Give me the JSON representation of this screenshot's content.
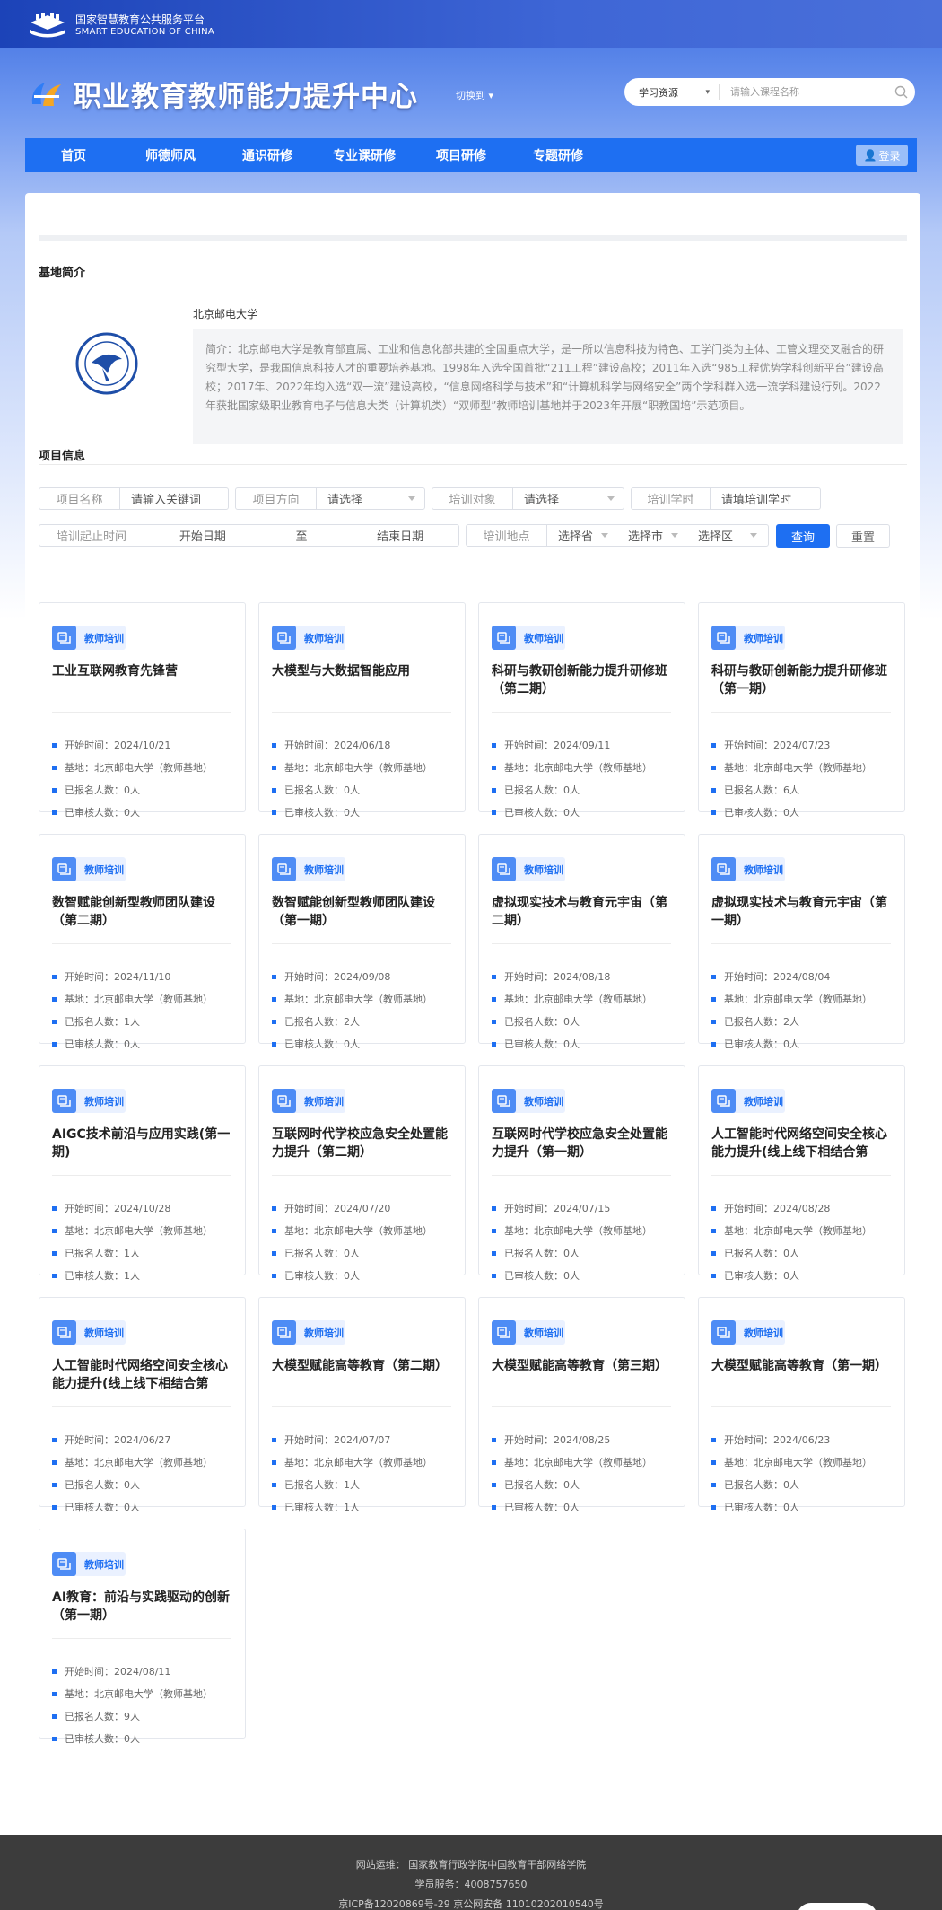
{
  "platform": {
    "name": "国家智慧教育公共服务平台",
    "name_en": "SMART EDUCATION OF CHINA"
  },
  "header": {
    "title": "职业教育教师能力提升中心",
    "switch_label": "切换到"
  },
  "search": {
    "category": "学习资源",
    "placeholder": "请输入课程名称"
  },
  "nav": {
    "items": [
      "首页",
      "师德师风",
      "通识研修",
      "专业课研修",
      "项目研修",
      "专题研修"
    ],
    "login_label": "登录"
  },
  "base": {
    "section_title": "基地简介",
    "name": "北京邮电大学",
    "intro": "简介：北京邮电大学是教育部直属、工业和信息化部共建的全国重点大学，是一所以信息科技为特色、工学门类为主体、工管文理交叉融合的研究型大学，是我国信息科技人才的重要培养基地。1998年入选全国首批“211工程”建设高校；2011年入选“985工程优势学科创新平台”建设高校；2017年、2022年均入选“双一流”建设高校，“信息网络科学与技术”和“计算机科学与网络安全”两个学科群入选一流学科建设行列。2022年获批国家级职业教育电子与信息大类（计算机类）“双师型”教师培训基地并于2023年开展“职教国培”示范项目。"
  },
  "project": {
    "section_title": "项目信息",
    "filters": {
      "name_label": "项目名称",
      "name_placeholder": "请输入关键词",
      "direction_label": "项目方向",
      "direction_value": "请选择",
      "target_label": "培训对象",
      "target_value": "请选择",
      "hours_label": "培训学时",
      "hours_placeholder": "请填培训学时",
      "period_label": "培训起止时间",
      "start_placeholder": "开始日期",
      "to": "至",
      "end_placeholder": "结束日期",
      "place_label": "培训地点",
      "province": "选择省",
      "city": "选择市",
      "district": "选择区",
      "query_label": "查询",
      "reset_label": "重置"
    }
  },
  "card_labels": {
    "badge": "教师培训",
    "start": "开始时间：",
    "base": "基地：",
    "enrolled": "已报名人数：",
    "reviewed": "已审核人数："
  },
  "courses": [
    {
      "title": "工业互联网教育先锋营",
      "start": "2024/10/21",
      "base": "北京邮电大学（教师基地）",
      "enrolled": "0人",
      "reviewed": "0人"
    },
    {
      "title": "大模型与大数据智能应用",
      "start": "2024/06/18",
      "base": "北京邮电大学（教师基地）",
      "enrolled": "0人",
      "reviewed": "0人"
    },
    {
      "title": "科研与教研创新能力提升研修班（第二期）",
      "start": "2024/09/11",
      "base": "北京邮电大学（教师基地）",
      "enrolled": "0人",
      "reviewed": "0人"
    },
    {
      "title": "科研与教研创新能力提升研修班（第一期）",
      "start": "2024/07/23",
      "base": "北京邮电大学（教师基地）",
      "enrolled": "6人",
      "reviewed": "0人"
    },
    {
      "title": "数智赋能创新型教师团队建设（第二期）",
      "start": "2024/11/10",
      "base": "北京邮电大学（教师基地）",
      "enrolled": "1人",
      "reviewed": "0人"
    },
    {
      "title": "数智赋能创新型教师团队建设（第一期）",
      "start": "2024/09/08",
      "base": "北京邮电大学（教师基地）",
      "enrolled": "2人",
      "reviewed": "0人"
    },
    {
      "title": "虚拟现实技术与教育元宇宙（第二期）",
      "start": "2024/08/18",
      "base": "北京邮电大学（教师基地）",
      "enrolled": "0人",
      "reviewed": "0人"
    },
    {
      "title": "虚拟现实技术与教育元宇宙（第一期）",
      "start": "2024/08/04",
      "base": "北京邮电大学（教师基地）",
      "enrolled": "2人",
      "reviewed": "0人"
    },
    {
      "title": "AIGC技术前沿与应用实践(第一期)",
      "start": "2024/10/28",
      "base": "北京邮电大学（教师基地）",
      "enrolled": "1人",
      "reviewed": "1人"
    },
    {
      "title": "互联网时代学校应急安全处置能力提升（第二期）",
      "start": "2024/07/20",
      "base": "北京邮电大学（教师基地）",
      "enrolled": "0人",
      "reviewed": "0人"
    },
    {
      "title": "互联网时代学校应急安全处置能力提升（第一期）",
      "start": "2024/07/15",
      "base": "北京邮电大学（教师基地）",
      "enrolled": "0人",
      "reviewed": "0人"
    },
    {
      "title": "人工智能时代网络空间安全核心能力提升(线上线下相结合第二…",
      "start": "2024/08/28",
      "base": "北京邮电大学（教师基地）",
      "enrolled": "0人",
      "reviewed": "0人"
    },
    {
      "title": "人工智能时代网络空间安全核心能力提升(线上线下相结合第一…",
      "start": "2024/06/27",
      "base": "北京邮电大学（教师基地）",
      "enrolled": "0人",
      "reviewed": "0人"
    },
    {
      "title": "大模型赋能高等教育（第二期）",
      "start": "2024/07/07",
      "base": "北京邮电大学（教师基地）",
      "enrolled": "1人",
      "reviewed": "1人"
    },
    {
      "title": "大模型赋能高等教育（第三期）",
      "start": "2024/08/25",
      "base": "北京邮电大学（教师基地）",
      "enrolled": "0人",
      "reviewed": "0人"
    },
    {
      "title": "大模型赋能高等教育（第一期）",
      "start": "2024/06/23",
      "base": "北京邮电大学（教师基地）",
      "enrolled": "0人",
      "reviewed": "0人"
    },
    {
      "title": "AI教育：前沿与实践驱动的创新（第一期）",
      "start": "2024/08/11",
      "base": "北京邮电大学（教师基地）",
      "enrolled": "9人",
      "reviewed": "0人"
    }
  ],
  "footer": {
    "operator": "网站运维：   国家教育行政学院中国教育干部网络学院",
    "service": "学员服务：4008757650",
    "icp": "京ICP备12020869号-29       京公网安备 11010202010540号"
  },
  "colors": {
    "primary": "#1e6ff2",
    "nav": "#1e6ff2",
    "footer_bg": "#3c3c3c"
  }
}
